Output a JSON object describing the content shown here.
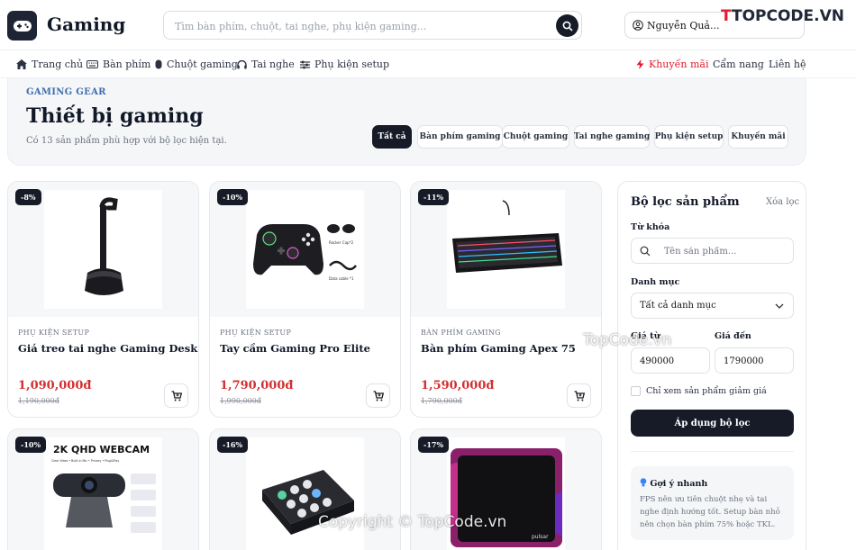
{
  "header": {
    "brand": "Gaming",
    "search_placeholder": "Tìm bàn phím, chuột, tai nghe, phụ kiện gaming...",
    "user_name": "Nguyễn Quả...",
    "watermark": "TOPCODE.VN"
  },
  "nav": {
    "items": [
      {
        "label": "Trang chủ",
        "icon": "home-icon"
      },
      {
        "label": "Bàn phím",
        "icon": "keyboard-icon"
      },
      {
        "label": "Chuột gaming",
        "icon": "mouse-icon"
      },
      {
        "label": "Tai nghe",
        "icon": "headphones-icon"
      },
      {
        "label": "Phụ kiện setup",
        "icon": "sliders-icon"
      }
    ],
    "right": [
      {
        "label": "Khuyến mãi",
        "icon": "bolt-icon"
      },
      {
        "label": "Cẩm nang"
      },
      {
        "label": "Liên hệ"
      }
    ]
  },
  "hero": {
    "eyebrow": "GAMING GEAR",
    "title": "Thiết bị gaming",
    "subtitle": "Có 13 sản phẩm phù hợp với bộ lọc hiện tại.",
    "chips": [
      "Tất cả",
      "Bàn phím gaming",
      "Chuột gaming",
      "Tai nghe gaming",
      "Phụ kiện setup",
      "Khuyến mãi"
    ]
  },
  "products": [
    {
      "badge": "-8%",
      "category": "PHỤ KIỆN SETUP",
      "name": "Giá treo tai nghe Gaming Desk Stand",
      "price": "1,090,000đ",
      "old_price": "1,190,000đ"
    },
    {
      "badge": "-10%",
      "category": "PHỤ KIỆN SETUP",
      "name": "Tay cầm Gaming Pro Elite",
      "price": "1,790,000đ",
      "old_price": "1,990,000đ"
    },
    {
      "badge": "-11%",
      "category": "BÀN PHÍM GAMING",
      "name": "Bàn phím Gaming Apex 75",
      "price": "1,590,000đ",
      "old_price": "1,790,000đ"
    },
    {
      "badge": "-10%",
      "webcam_headline": "2K QHD WEBCAM",
      "webcam_tags": "Clear Video • Built-in Mic • Privacy • Plug&Play"
    },
    {
      "badge": "-16%"
    },
    {
      "badge": "-17%",
      "mousepad_brand": "pulsar"
    }
  ],
  "controller_labels": {
    "caps": "Rocker Cap*2",
    "cable": "Data cable *1"
  },
  "filter": {
    "title": "Bộ lọc sản phẩm",
    "clear": "Xóa lọc",
    "keyword_label": "Từ khóa",
    "keyword_placeholder": "Tên sản phẩm...",
    "category_label": "Danh mục",
    "category_value": "Tất cả danh mục",
    "price_from_label": "Giá từ",
    "price_to_label": "Giá đến",
    "price_from": "490000",
    "price_to": "1790000",
    "discount_only": "Chỉ xem sản phẩm giảm giá",
    "apply": "Áp dụng bộ lọc",
    "tip_title": "Gợi ý nhanh",
    "tip_body": "FPS nên ưu tiên chuột nhẹ và tai nghe định hướng tốt. Setup bàn nhỏ nên chọn bàn phím 75% hoặc TKL."
  },
  "watermarks": {
    "center": "TopCode.vn",
    "bottom": "Copyright © TopCode.vn"
  },
  "colors": {
    "dark": "#161b27",
    "price": "#d32f2f",
    "promo": "#e11d2e",
    "eyebrow": "#3f6fb0"
  }
}
